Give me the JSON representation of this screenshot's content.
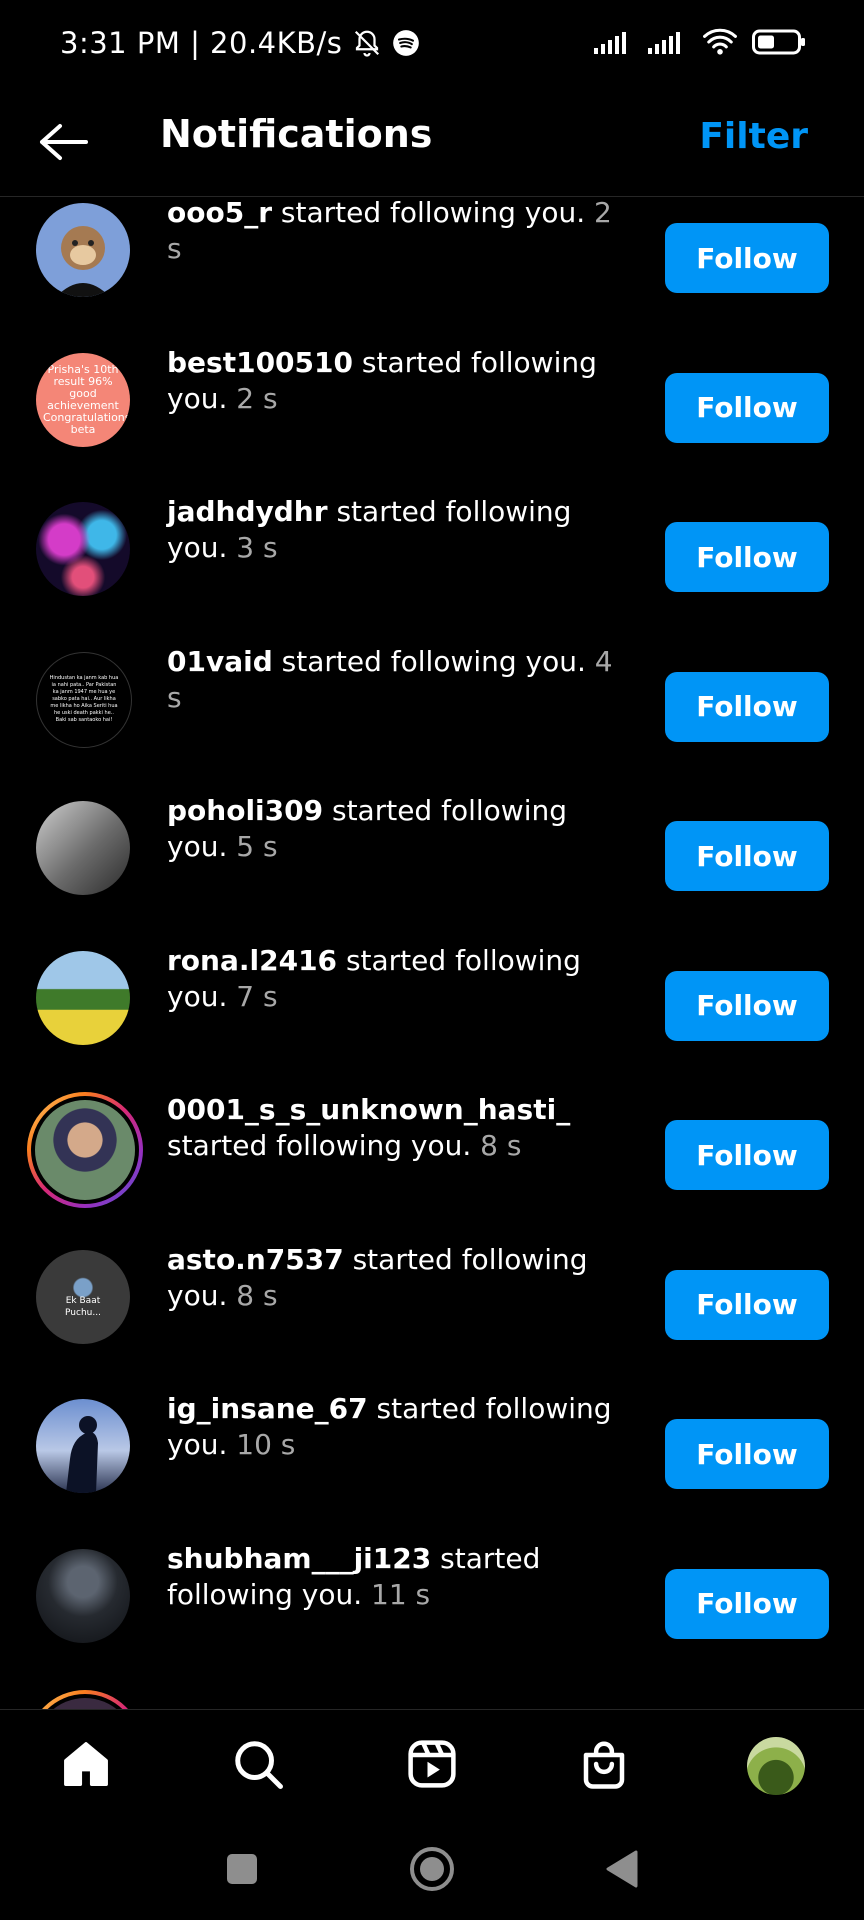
{
  "status_bar": {
    "time_info": "3:31 PM | 20.4KB/s",
    "icons": [
      "mute-bell-icon",
      "spotify-icon",
      "signal-icon",
      "signal-icon",
      "wifi-icon",
      "battery-icon"
    ]
  },
  "header": {
    "title": "Notifications",
    "filter_label": "Filter",
    "back_icon": "arrow-left-icon"
  },
  "notifications": [
    {
      "username": "ooo5_r",
      "action": " started following you.",
      "time": " 2 s",
      "button": "Follow"
    },
    {
      "username": "best100510",
      "action": " started following you.",
      "time": " 2 s",
      "button": "Follow"
    },
    {
      "username": "jadhdydhr",
      "action": " started following you.",
      "time": " 3 s",
      "button": "Follow"
    },
    {
      "username": "01vaid",
      "action": " started following you.",
      "time": " 4 s",
      "button": "Follow"
    },
    {
      "username": "poholi309",
      "action": " started following you.",
      "time": " 5 s",
      "button": "Follow"
    },
    {
      "username": "rona.l2416",
      "action": " started following you.",
      "time": " 7 s",
      "button": "Follow"
    },
    {
      "username": "0001_s_s_unknown_hasti_",
      "action": " started following you.",
      "time": " 8 s",
      "button": "Follow"
    },
    {
      "username": "asto.n7537",
      "action": " started following you.",
      "time": " 8 s",
      "button": "Follow"
    },
    {
      "username": "ig_insane_67",
      "action": " started following you.",
      "time": " 10 s",
      "button": "Follow"
    },
    {
      "username": "shubham___ji123",
      "action": " started following you.",
      "time": " 11 s",
      "button": "Follow"
    }
  ],
  "avatars": {
    "a2_text": "Prisha's 10th result 96% good achievement Congratulations beta",
    "a4_text": "Hindustan ka janm kab hua ia nahi pata.. Par Pakistan ka janm 1947 me hua ye sabko pata hai.. Aur likha me likha ho Aika Seriti hua he uski death pakki he.. Baki sab santaoko hai!",
    "a8_text": "Ek Baat Puchu..."
  },
  "bottom_nav": {
    "items": [
      "home-icon",
      "search-icon",
      "reels-icon",
      "shop-icon",
      "profile-avatar"
    ]
  },
  "system_nav": {
    "items": [
      "recents-square-icon",
      "home-circle-icon",
      "back-triangle-icon"
    ]
  },
  "colors": {
    "accent": "#0095f6",
    "background": "#000000",
    "secondary_text": "#a8a8a8"
  }
}
